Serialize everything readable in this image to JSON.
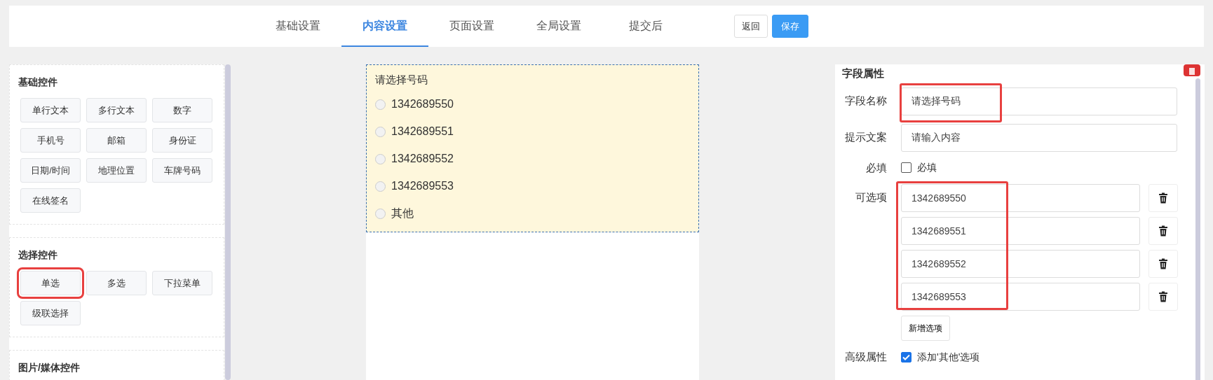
{
  "tabs": [
    {
      "label": "基础设置",
      "selected": false
    },
    {
      "label": "内容设置",
      "selected": true
    },
    {
      "label": "页面设置",
      "selected": false
    },
    {
      "label": "全局设置",
      "selected": false
    },
    {
      "label": "提交后",
      "selected": false
    }
  ],
  "header_buttons": [
    {
      "label": "返回",
      "kind": "secondary"
    },
    {
      "label": "保存",
      "kind": "primary"
    }
  ],
  "palette": [
    {
      "title": "基础控件",
      "items": [
        {
          "label": "单行文本",
          "highlighted": false
        },
        {
          "label": "多行文本",
          "highlighted": false
        },
        {
          "label": "数字",
          "highlighted": false
        },
        {
          "label": "手机号",
          "highlighted": false
        },
        {
          "label": "邮箱",
          "highlighted": false
        },
        {
          "label": "身份证",
          "highlighted": false
        },
        {
          "label": "日期/时间",
          "highlighted": false
        },
        {
          "label": "地理位置",
          "highlighted": false
        },
        {
          "label": "车牌号码",
          "highlighted": false
        },
        {
          "label": "在线签名",
          "highlighted": false
        }
      ]
    },
    {
      "title": "选择控件",
      "items": [
        {
          "label": "单选",
          "highlighted": true
        },
        {
          "label": "多选",
          "highlighted": false
        },
        {
          "label": "下拉菜单",
          "highlighted": false
        },
        {
          "label": "级联选择",
          "highlighted": false
        }
      ]
    },
    {
      "title": "图片/媒体控件"
    }
  ],
  "preview": {
    "title": "请选择号码",
    "options": [
      {
        "label": "1342689550",
        "selected": false
      },
      {
        "label": "1342689551",
        "selected": false
      },
      {
        "label": "1342689552",
        "selected": false
      },
      {
        "label": "1342689553",
        "selected": false
      },
      {
        "label": "其他",
        "selected": false
      }
    ]
  },
  "properties": {
    "title": "字段属性",
    "field_name": {
      "label": "字段名称",
      "value": "请选择号码",
      "highlighted": true
    },
    "hint": {
      "label": "提示文案",
      "value": "请输入内容"
    },
    "required": {
      "label": "必填",
      "option_label": "必填",
      "checked": false
    },
    "options": {
      "label": "可选项",
      "highlighted": true,
      "items": [
        "1342689550",
        "1342689551",
        "1342689552",
        "1342689553"
      ],
      "add_button": "新增选项"
    },
    "advanced": {
      "label": "高级属性",
      "option_label": "添加'其他'选项",
      "checked": true
    }
  }
}
